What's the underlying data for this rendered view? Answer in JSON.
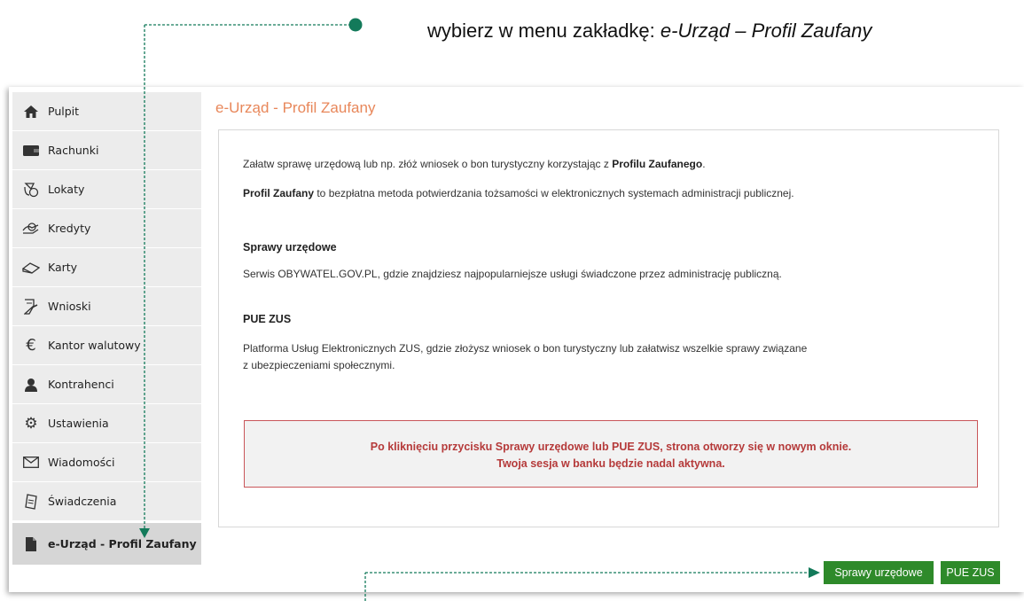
{
  "instruction": {
    "prefix": "wybierz w menu zakładkę: ",
    "emphasis": "e-Urząd – Profil Zaufany"
  },
  "sidebar": {
    "items": [
      {
        "label": "Pulpit",
        "icon": "home-icon"
      },
      {
        "label": "Rachunki",
        "icon": "wallet-icon"
      },
      {
        "label": "Lokaty",
        "icon": "deposit-icon"
      },
      {
        "label": "Kredyty",
        "icon": "loan-icon"
      },
      {
        "label": "Karty",
        "icon": "cards-icon"
      },
      {
        "label": "Wnioski",
        "icon": "forms-icon"
      },
      {
        "label": "Kantor walutowy",
        "icon": "euro-icon"
      },
      {
        "label": "Kontrahenci",
        "icon": "contacts-icon"
      },
      {
        "label": "Ustawienia",
        "icon": "gear-icon"
      },
      {
        "label": "Wiadomości",
        "icon": "envelope-icon"
      },
      {
        "label": "Świadczenia",
        "icon": "benefits-icon"
      },
      {
        "label": "e-Urząd - Profil Zaufany",
        "icon": "document-icon",
        "active": true
      }
    ]
  },
  "main": {
    "title": "e-Urząd - Profil Zaufany",
    "intro_1_text": "Załatw sprawę urzędową lub np. złóż wniosek o bon turystyczny korzystając z ",
    "intro_1_bold": "Profilu Zaufanego",
    "intro_1_end": ".",
    "intro_2_bold": "Profil Zaufany",
    "intro_2_text": " to bezpłatna metoda potwierdzania tożsamości w elektronicznych systemach administracji publicznej.",
    "section_1_heading": "Sprawy urzędowe",
    "section_1_text": "Serwis OBYWATEL.GOV.PL, gdzie znajdziesz najpopularniejsze usługi świadczone przez administrację publiczną.",
    "section_2_heading": "PUE ZUS",
    "section_2_text_line1": "Platforma Usług Elektronicznych ZUS, gdzie złożysz wniosek o bon turystyczny lub załatwisz wszelkie sprawy związane",
    "section_2_text_line2": "z ubezpieczeniami społecznymi.",
    "alert_line1": "Po kliknięciu przycisku Sprawy urzędowe lub PUE ZUS, strona otworzy się w nowym oknie.",
    "alert_line2": "Twoja sesja w banku będzie nadal aktywna."
  },
  "buttons": {
    "sprawy_label": "Sprawy urzędowe",
    "pue_label": "PUE ZUS"
  },
  "colors": {
    "title_orange": "#e8875a",
    "button_green": "#2e8a2a",
    "alert_red": "#b53a3a",
    "annotation_green": "#137a5a"
  }
}
